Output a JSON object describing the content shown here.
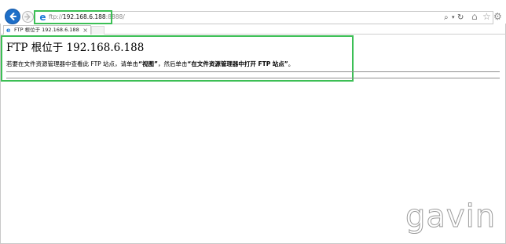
{
  "browser": {
    "address_bar": {
      "scheme": "ftp://",
      "host": "192.168.6.188",
      "port_path": ":8888/"
    },
    "tab": {
      "title": "FTP 根位于 192.168.6.188",
      "close_glyph": "×"
    },
    "icons": [
      "back-icon",
      "forward-icon",
      "ie-logo-icon",
      "search-icon",
      "dropdown-icon",
      "refresh-icon",
      "home-icon",
      "star-icon",
      "gear-icon"
    ]
  },
  "page": {
    "heading": "FTP 根位于 192.168.6.188",
    "instruction": {
      "prefix": "若要在文件资源管理器中查看此 FTP 站点，请单击",
      "view_label": "“视图”",
      "middle": "，然后单击",
      "open_label": "“在文件资源管理器中打开 FTP 站点”",
      "suffix": "。"
    }
  },
  "watermark": "gavin",
  "colors": {
    "accent": "#1e6fc8",
    "highlight_box": "#3cbf55"
  }
}
